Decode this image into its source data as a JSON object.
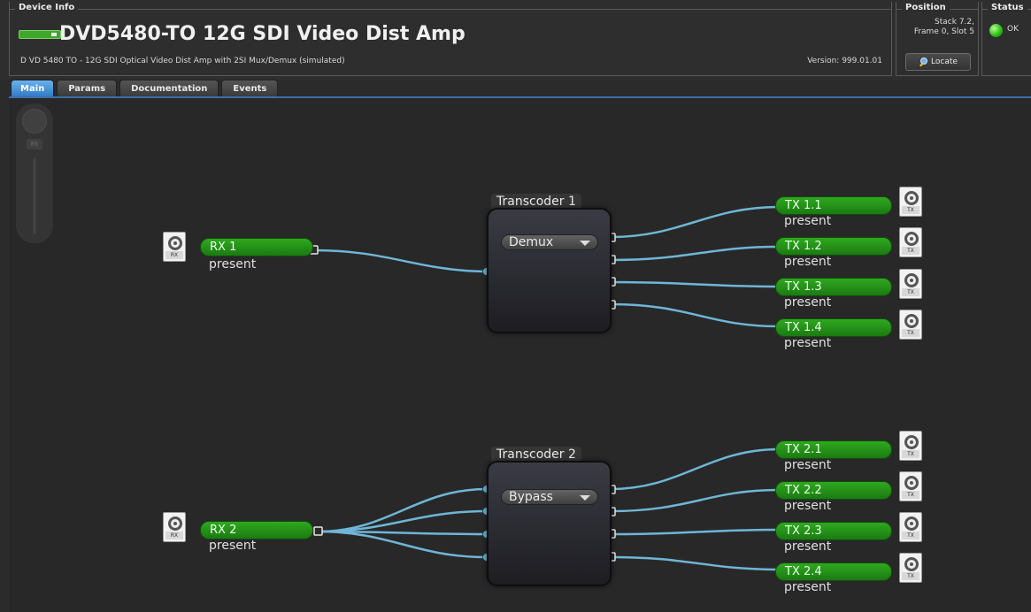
{
  "header": {
    "device_info_label": "Device Info",
    "title": "DVD5480-TO 12G SDI Video Dist Amp",
    "description": "D VD 5480 TO - 12G SDI Optical Video Dist Amp with 2SI Mux/Demux (simulated)",
    "version": "Version: 999.01.01",
    "position_label": "Position",
    "position_line1": "Stack 7.2,",
    "position_line2": "Frame 0, Slot 5",
    "locate_label": "Locate",
    "status_label": "Status",
    "status_value": "OK",
    "status_color": "#2fbf1a"
  },
  "tabs": [
    {
      "label": "Main",
      "active": true
    },
    {
      "label": "Params"
    },
    {
      "label": "Documentation"
    },
    {
      "label": "Events"
    }
  ],
  "nav": {
    "fit_label": "Fit"
  },
  "diagram": {
    "receivers": [
      {
        "label": "RX 1",
        "status": "present",
        "port_tag": "RX"
      },
      {
        "label": "RX 2",
        "status": "present",
        "port_tag": "RX"
      }
    ],
    "transcoders": [
      {
        "label": "Transcoder 1",
        "mode": "Demux"
      },
      {
        "label": "Transcoder 2",
        "mode": "Bypass"
      }
    ],
    "transmitters": [
      {
        "label": "TX 1.1",
        "status": "present",
        "port_tag": "TX"
      },
      {
        "label": "TX 1.2",
        "status": "present",
        "port_tag": "TX"
      },
      {
        "label": "TX 1.3",
        "status": "present",
        "port_tag": "TX"
      },
      {
        "label": "TX 1.4",
        "status": "present",
        "port_tag": "TX"
      },
      {
        "label": "TX 2.1",
        "status": "present",
        "port_tag": "TX"
      },
      {
        "label": "TX 2.2",
        "status": "present",
        "port_tag": "TX"
      },
      {
        "label": "TX 2.3",
        "status": "present",
        "port_tag": "TX"
      },
      {
        "label": "TX 2.4",
        "status": "present",
        "port_tag": "TX"
      }
    ],
    "wire_color": "#6fb6d6"
  }
}
